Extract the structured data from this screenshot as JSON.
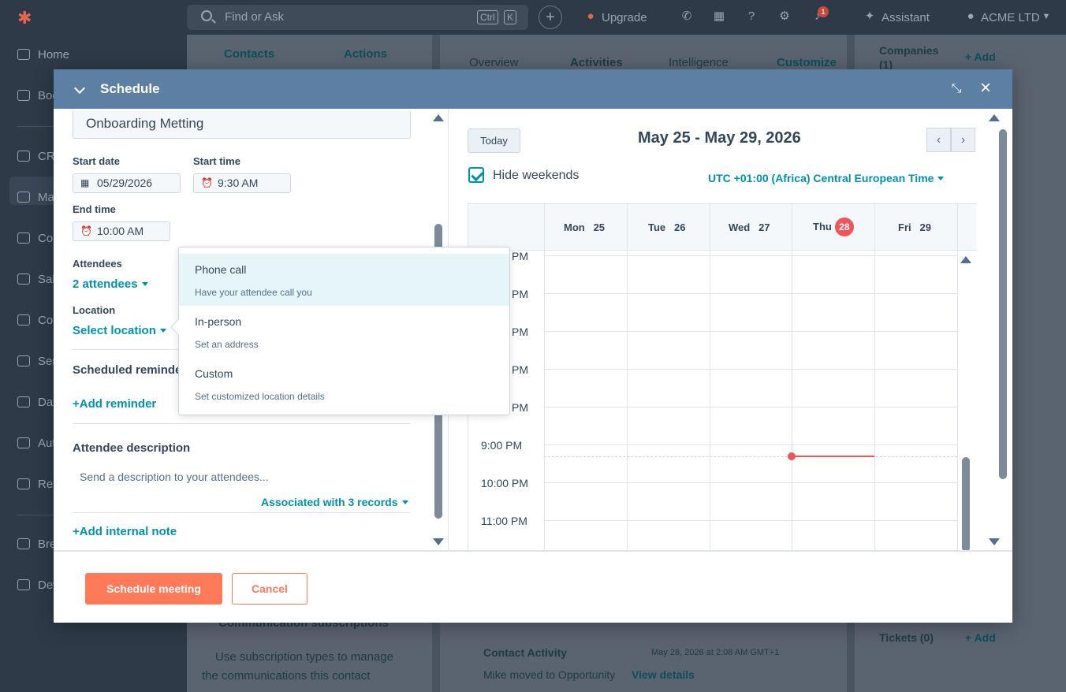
{
  "topbar": {
    "search_placeholder": "Find or Ask",
    "kbd_ctrl": "Ctrl",
    "kbd_k": "K",
    "upgrade": "Upgrade",
    "assistant": "Assistant",
    "account": "ACME LTD",
    "notification_count": "1"
  },
  "sidebar": {
    "items": [
      "Home",
      "Boo",
      "CR",
      "Ma",
      "Cor",
      "Sal",
      "Cor",
      "Ser",
      "Dat",
      "Aut",
      "Rep",
      "Bre",
      "Dev"
    ]
  },
  "background": {
    "breadcrumb": "Contacts",
    "actions": "Actions",
    "tabs": [
      "Overview",
      "Activities",
      "Intelligence"
    ],
    "customize": "Customize",
    "companies": "Companies",
    "companies_count": "(1)",
    "add": "+ Add",
    "tickets": "Tickets (0)",
    "add2": "+ Add",
    "comm_subs": "Communication subscriptions",
    "comm_text_1": "Use subscription types to manage",
    "comm_text_2": "the communications this contact",
    "contact_activity": "Contact Activity",
    "activity_time": "May 28, 2026 at 2:08 AM GMT+1",
    "activity_text": "Mike moved to Opportunity",
    "view_details": "View details"
  },
  "modal": {
    "title": "Schedule",
    "meeting_title": "Onboarding Metting",
    "start_date_label": "Start date",
    "start_date": "05/29/2026",
    "start_time_label": "Start time",
    "start_time": "9:30 AM",
    "end_time_label": "End time",
    "end_time": "10:00 AM",
    "attendees_label": "Attendees",
    "attendees_value": "2 attendees",
    "location_label": "Location",
    "location_value": "Select location",
    "reminders_label": "Scheduled reminde",
    "add_reminder": "+Add reminder",
    "attendee_desc_label": "Attendee description",
    "attendee_desc_placeholder": "Send a description to your attendees...",
    "associated": "Associated with 3 records",
    "add_internal_note": "+Add internal note",
    "schedule_button": "Schedule meeting",
    "cancel_button": "Cancel"
  },
  "calendar": {
    "today": "Today",
    "range": "May 25 - May 29, 2026",
    "hide_weekends": "Hide weekends",
    "timezone": "UTC +01:00 (Africa) Central European Time",
    "days": [
      {
        "name": "Mon",
        "num": "25"
      },
      {
        "name": "Tue",
        "num": "26"
      },
      {
        "name": "Wed",
        "num": "27"
      },
      {
        "name": "Thu",
        "num": "28"
      },
      {
        "name": "Fri",
        "num": "29"
      }
    ],
    "hours_partial": [
      "PM",
      "PM",
      "PM",
      "PM",
      "PM"
    ],
    "hours": [
      "9:00 PM",
      "10:00 PM",
      "11:00 PM"
    ]
  },
  "location_menu": {
    "options": [
      {
        "title": "Phone call",
        "sub": "Have your attendee call you"
      },
      {
        "title": "In-person",
        "sub": "Set an address"
      },
      {
        "title": "Custom",
        "sub": "Set customized location details"
      }
    ]
  },
  "colors": {
    "accent": "#0091ae",
    "primary_button": "#ff7a59",
    "modal_header": "#5c7fa3",
    "today_badge": "#f2545b"
  }
}
